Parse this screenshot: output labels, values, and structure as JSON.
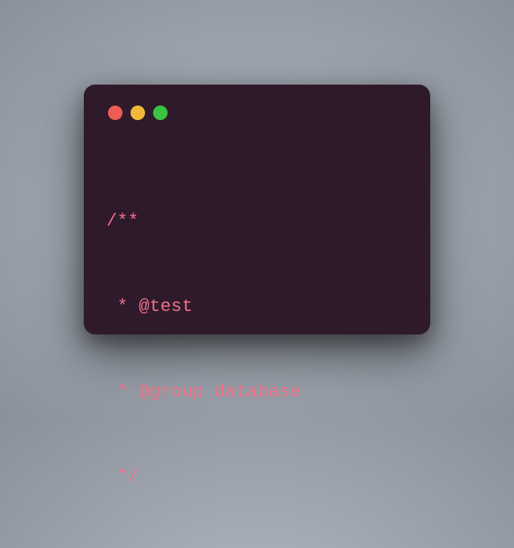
{
  "window": {
    "trafficLights": {
      "red": "#ed5d53",
      "yellow": "#f0b93b",
      "green": "#3cc242"
    }
  },
  "code": {
    "lines": [
      "/**",
      " * @test",
      " * @group database",
      " */"
    ]
  }
}
